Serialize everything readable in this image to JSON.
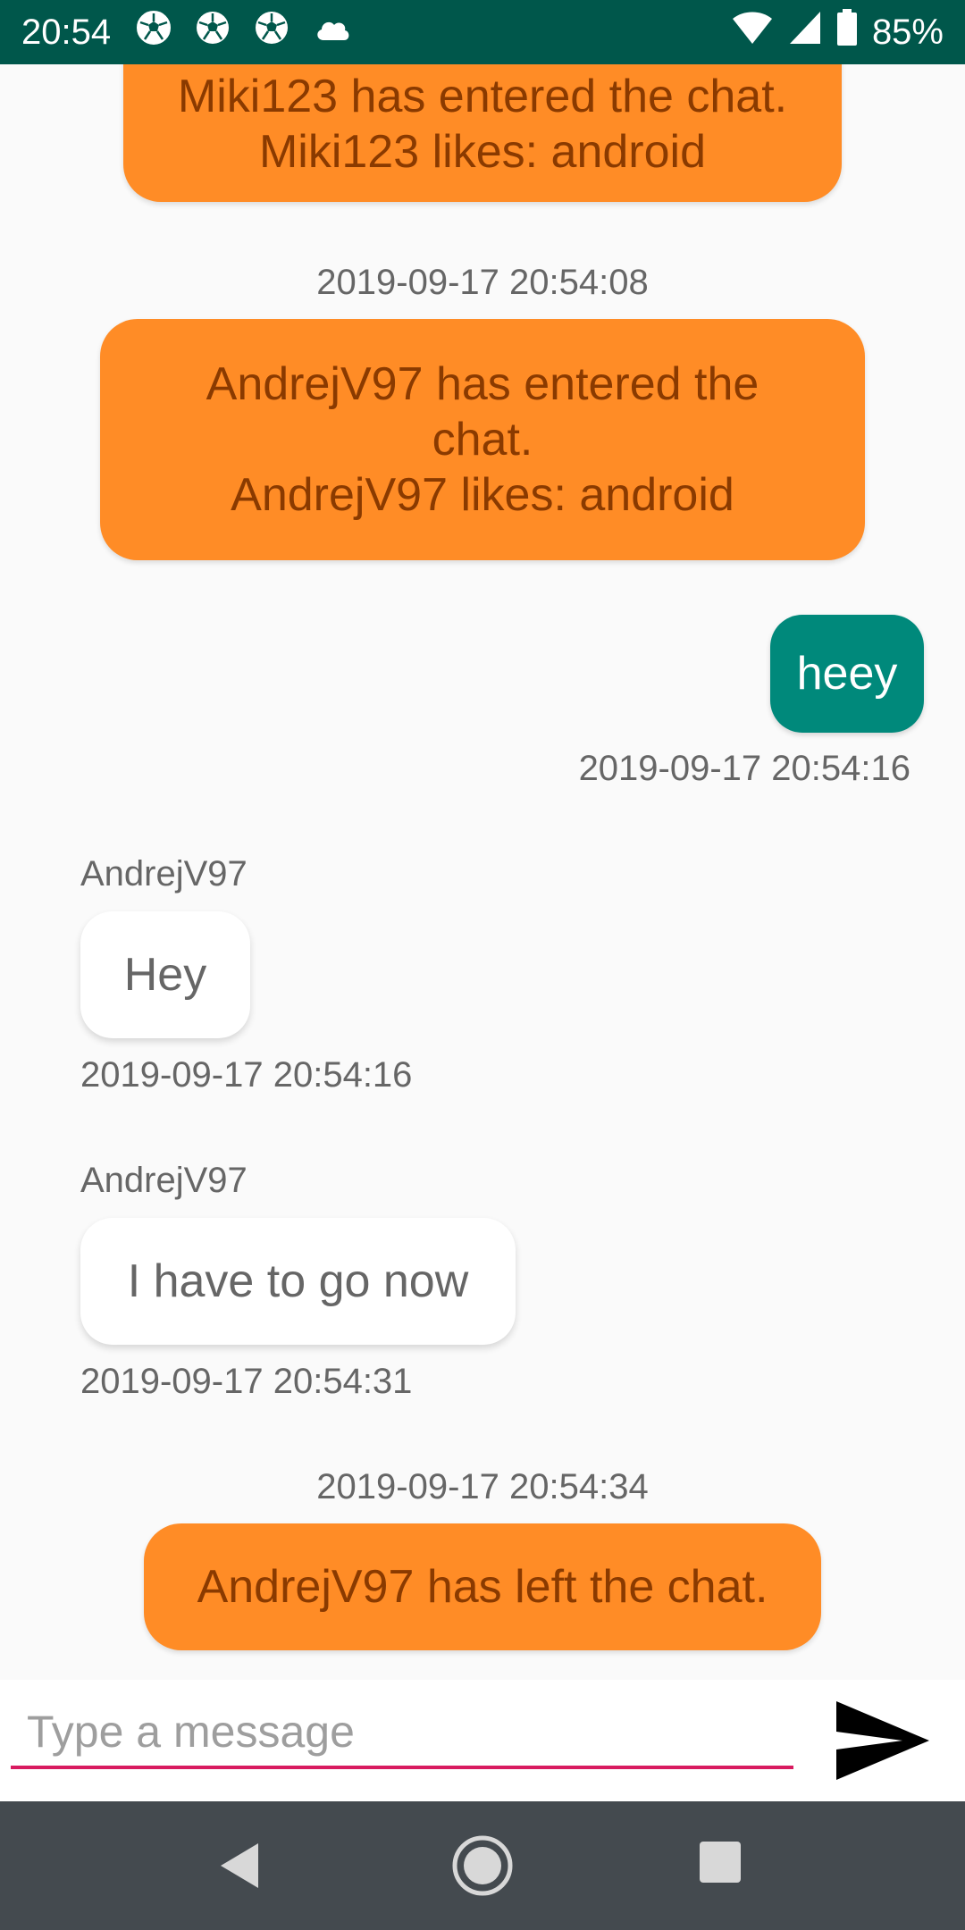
{
  "status_bar": {
    "time": "20:54",
    "battery": "85%",
    "notification_icons": [
      "soccer-ball-icon",
      "soccer-ball-icon",
      "soccer-ball-icon",
      "cloud-icon"
    ],
    "system_icons": [
      "wifi-icon",
      "cellular-signal-icon",
      "battery-icon"
    ],
    "background_color": "#00574b"
  },
  "messages": {
    "m1": {
      "line1": "Miki123 has entered the chat.",
      "line2": "Miki123 likes: android"
    },
    "m2": {
      "timestamp": "2019-09-17 20:54:08",
      "line1": "AndrejV97 has entered the",
      "line2": "chat.",
      "line3": "AndrejV97 likes: android"
    },
    "m3": {
      "text": "heey",
      "timestamp": "2019-09-17 20:54:16"
    },
    "m4": {
      "sender": "AndrejV97",
      "text": "Hey",
      "timestamp": "2019-09-17 20:54:16"
    },
    "m5": {
      "sender": "AndrejV97",
      "text": "I have to go now",
      "timestamp": "2019-09-17 20:54:31"
    },
    "m6": {
      "timestamp": "2019-09-17 20:54:34",
      "text": "AndrejV97 has left the chat."
    }
  },
  "colors": {
    "system_bubble": "#ff8c26",
    "own_bubble": "#00897b",
    "other_bubble": "#ffffff",
    "input_underline": "#d81b60",
    "nav_bar": "#444a4f"
  },
  "input": {
    "placeholder": "Type a message",
    "value": "",
    "send_icon": "send-icon"
  },
  "nav_bar": {
    "buttons": [
      "back-icon",
      "home-icon",
      "recents-icon"
    ]
  }
}
